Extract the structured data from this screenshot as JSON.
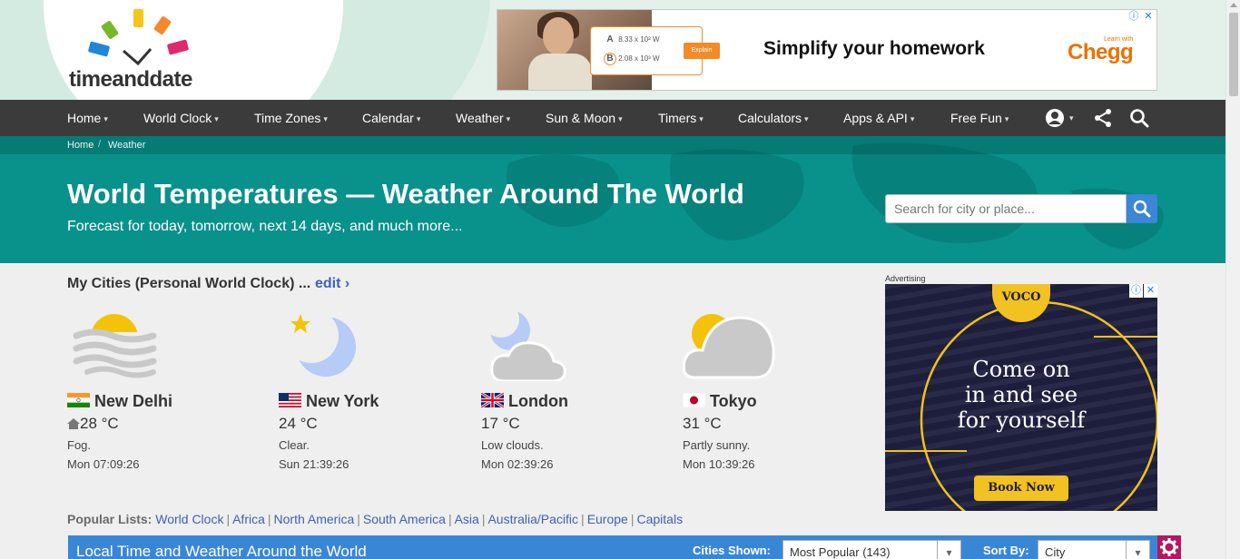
{
  "logo": {
    "text": "timeanddate"
  },
  "top_ad": {
    "headline": "Simplify your homework",
    "brand": "Chegg",
    "brand_tag": "Learn with",
    "row_a_label": "A",
    "row_a_value": "8.33 x 10² W",
    "row_b_label": "B",
    "row_b_value": "2.08 x 10³ W",
    "explain": "Explain",
    "info_icon": "ⓘ",
    "close_icon": "✕"
  },
  "nav": {
    "items": [
      {
        "label": "Home"
      },
      {
        "label": "World Clock"
      },
      {
        "label": "Time Zones"
      },
      {
        "label": "Calendar"
      },
      {
        "label": "Weather"
      },
      {
        "label": "Sun & Moon"
      },
      {
        "label": "Timers"
      },
      {
        "label": "Calculators"
      },
      {
        "label": "Apps & API"
      },
      {
        "label": "Free Fun"
      }
    ],
    "icons": [
      "account-icon",
      "share-icon",
      "search-icon"
    ]
  },
  "breadcrumb": {
    "home": "Home",
    "current": "Weather",
    "separator": "/"
  },
  "hero": {
    "title": "World Temperatures — Weather Around The World",
    "subtitle": "Forecast for today, tomorrow, next 14 days, and much more...",
    "search_placeholder": "Search for city or place..."
  },
  "my_cities": {
    "title": "My Cities (Personal World Clock) ...",
    "edit": "edit ›",
    "cities": [
      {
        "name": "New Delhi",
        "temp": "28 °C",
        "desc": "Fog.",
        "time": "Mon 07:09:26",
        "icon": "fog-icon",
        "flag": "india-flag",
        "home": true
      },
      {
        "name": "New York",
        "temp": "24 °C",
        "desc": "Clear.",
        "time": "Sun 21:39:26",
        "icon": "moon-star-icon",
        "flag": "usa-flag",
        "home": false
      },
      {
        "name": "London",
        "temp": "17 °C",
        "desc": "Low clouds.",
        "time": "Mon 02:39:26",
        "icon": "moon-cloud-icon",
        "flag": "uk-flag",
        "home": false
      },
      {
        "name": "Tokyo",
        "temp": "31 °C",
        "desc": "Partly sunny.",
        "time": "Mon 10:39:26",
        "icon": "sun-cloud-icon",
        "flag": "japan-flag",
        "home": false
      }
    ]
  },
  "right_ad": {
    "label": "Advertising",
    "brand": "VOCO",
    "line1": "Come on",
    "line2": "in and see",
    "line3": "for yourself",
    "cta": "Book Now"
  },
  "popular_lists": {
    "label": "Popular Lists:",
    "links": [
      "World Clock",
      "Africa",
      "North America",
      "South America",
      "Asia",
      "Australia/Pacific",
      "Europe",
      "Capitals"
    ]
  },
  "local_time": {
    "title": "Local Time and Weather Around the World",
    "cities_shown_label": "Cities Shown:",
    "cities_shown_value": "Most Popular (143)",
    "sort_by_label": "Sort By:",
    "sort_by_value": "City"
  },
  "colors": {
    "nav_bg": "#3b3b3b",
    "hero_bg": "#09918b",
    "link": "#3b62b6",
    "accent_blue": "#3a86d6",
    "chegg_orange": "#eb7100",
    "voco_yellow": "#f2c122"
  }
}
